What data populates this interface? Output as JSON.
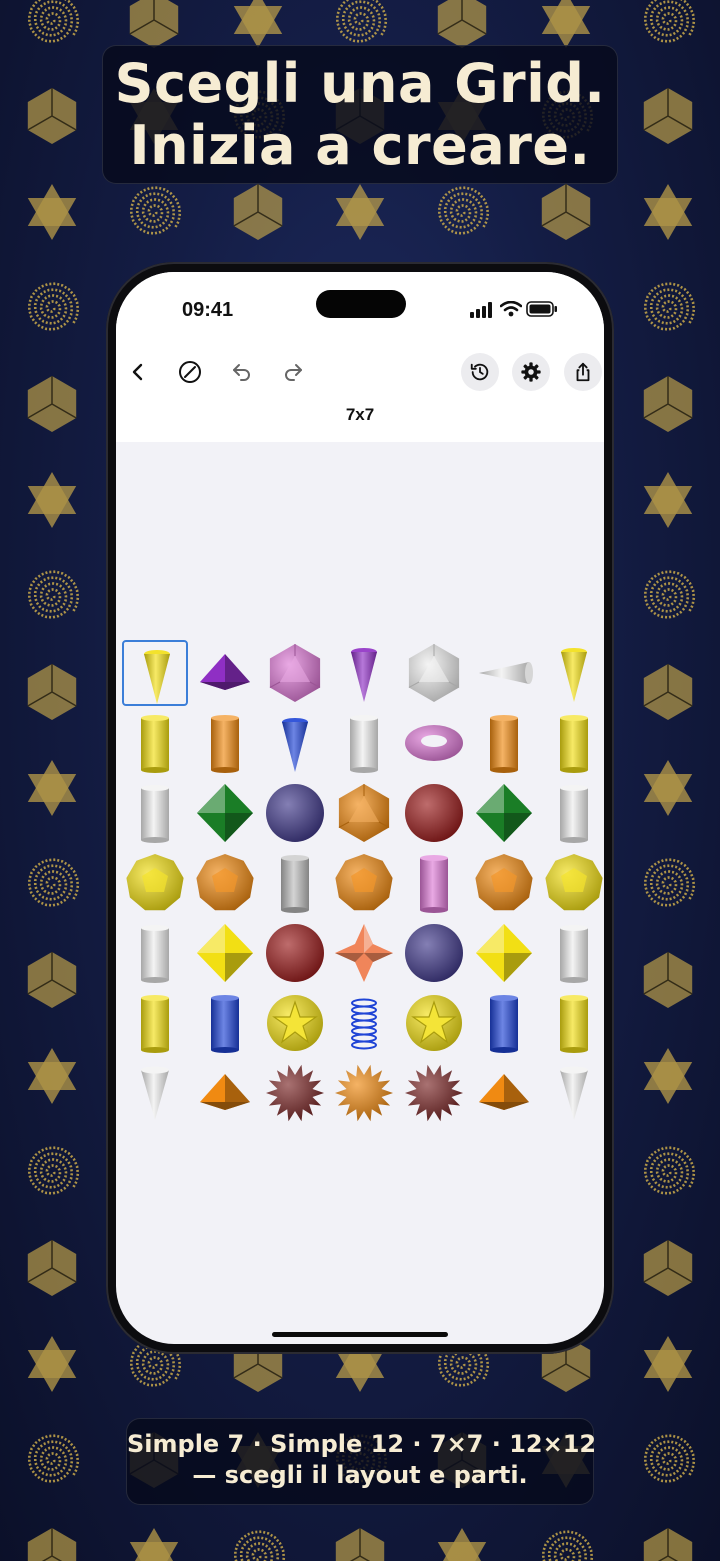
{
  "headline": {
    "line1": "Scegli una Grid.",
    "line2": "Inizia a creare."
  },
  "status_bar": {
    "time": "09:41",
    "icons": [
      "signal-icon",
      "wifi-icon",
      "battery-icon"
    ]
  },
  "toolbar": {
    "left": [
      "back-icon",
      "clear-icon",
      "undo-icon",
      "redo-icon"
    ],
    "right": [
      "history-icon",
      "gear-icon",
      "share-icon"
    ],
    "grid_name": "7x7"
  },
  "grid": {
    "rows": 7,
    "cols": 7,
    "selected": [
      0,
      0
    ],
    "cells": [
      [
        "yellow cone",
        "purple pyramid",
        "pink icosahedron",
        "purple cone",
        "white icosahedron",
        "white cone (sideways)",
        "yellow cone"
      ],
      [
        "yellow cylinder",
        "orange cylinder",
        "blue cone",
        "white cylinder",
        "pink torus",
        "orange cylinder",
        "yellow cylinder"
      ],
      [
        "white cylinder",
        "green octahedron",
        "navy sphere",
        "orange icosahedron",
        "red sphere",
        "green octahedron",
        "white cylinder"
      ],
      [
        "yellow dodecahedron",
        "orange dodecahedron",
        "gray cylinder",
        "orange dodecahedron",
        "pink cylinder",
        "orange dodecahedron",
        "yellow dodecahedron"
      ],
      [
        "white cylinder",
        "yellow octahedron",
        "red sphere",
        "salmon star octahedron",
        "navy sphere",
        "yellow octahedron",
        "white cylinder"
      ],
      [
        "yellow cylinder",
        "blue cylinder",
        "yellow star dodecahedron",
        "blue spring",
        "yellow star dodecahedron",
        "blue cylinder",
        "yellow cylinder"
      ],
      [
        "white cone (inverted)",
        "orange pyramid",
        "maroon spiky ball",
        "orange spiky ball",
        "maroon spiky ball",
        "orange pyramid",
        "white cone (inverted)"
      ]
    ]
  },
  "background": {
    "pattern_icons": [
      "spiral-icon",
      "star-tetrahedron-icon",
      "cube-icon",
      "pyramid-icon",
      "hexagon-star-icon",
      "triangle-icon"
    ]
  },
  "footer": {
    "line1": "Simple 7 · Simple 12 · 7×7 · 12×12",
    "line2": "— scegli il layout e parti."
  },
  "colors": {
    "gold": "#c9a94a",
    "cream": "#f6ecd3",
    "selection": "#3b7ed8"
  }
}
